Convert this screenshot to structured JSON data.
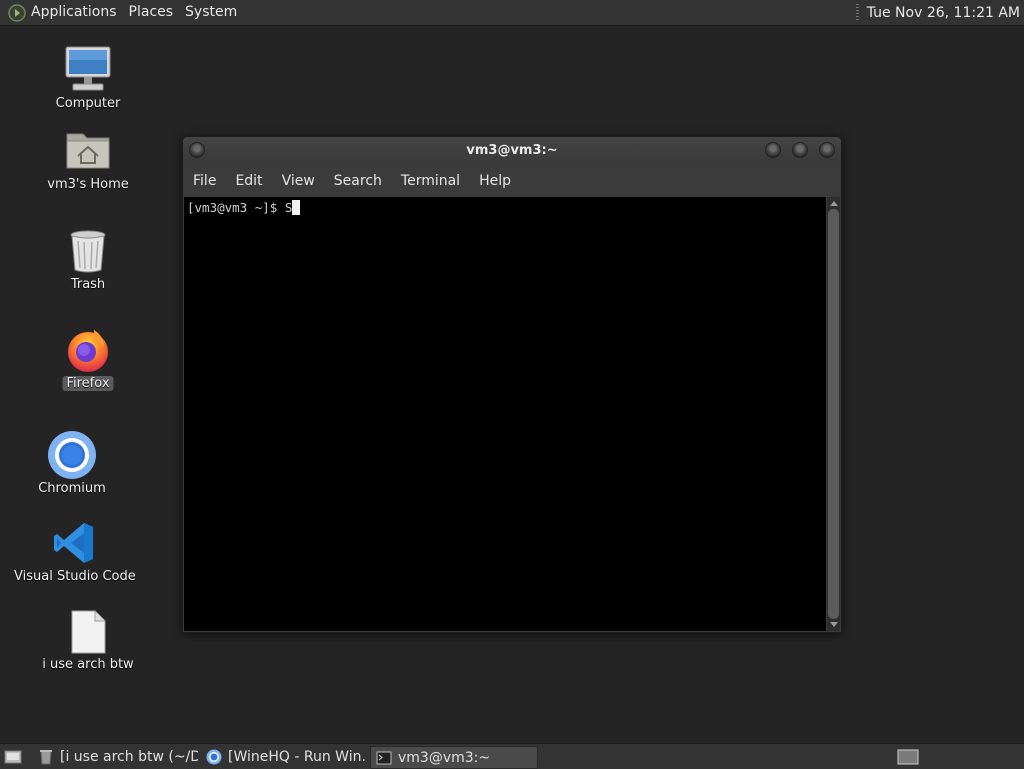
{
  "top_panel": {
    "menus": [
      "Applications",
      "Places",
      "System"
    ],
    "clock": "Tue Nov 26, 11:21 AM"
  },
  "desktop": {
    "icons": [
      {
        "label": "Computer",
        "icon": "computer-icon"
      },
      {
        "label": "vm3's Home",
        "icon": "home-folder-icon"
      },
      {
        "label": "Trash",
        "icon": "trash-icon"
      },
      {
        "label": "Firefox",
        "icon": "firefox-icon"
      },
      {
        "label": "Chromium",
        "icon": "chromium-icon"
      },
      {
        "label": "Visual Studio Code",
        "icon": "vscode-icon"
      },
      {
        "label": "i use arch btw",
        "icon": "text-file-icon"
      }
    ]
  },
  "terminal": {
    "title": "vm3@vm3:~",
    "menu": [
      "File",
      "Edit",
      "View",
      "Search",
      "Terminal",
      "Help"
    ],
    "prompt": "[vm3@vm3 ~]$ S"
  },
  "taskbar": {
    "tasks": [
      {
        "label": "[i use arch btw (~/D...",
        "icon": "text-editor-icon"
      },
      {
        "label": "[WineHQ - Run Win...",
        "icon": "chromium-icon"
      },
      {
        "label": "vm3@vm3:~",
        "icon": "terminal-icon"
      }
    ]
  },
  "colors": {
    "panel": "#333333",
    "desktop": "#242424",
    "terminal_bg": "#000000",
    "vscode_blue": "#2f8fe0",
    "chromium_blue": "#4a90e2"
  }
}
